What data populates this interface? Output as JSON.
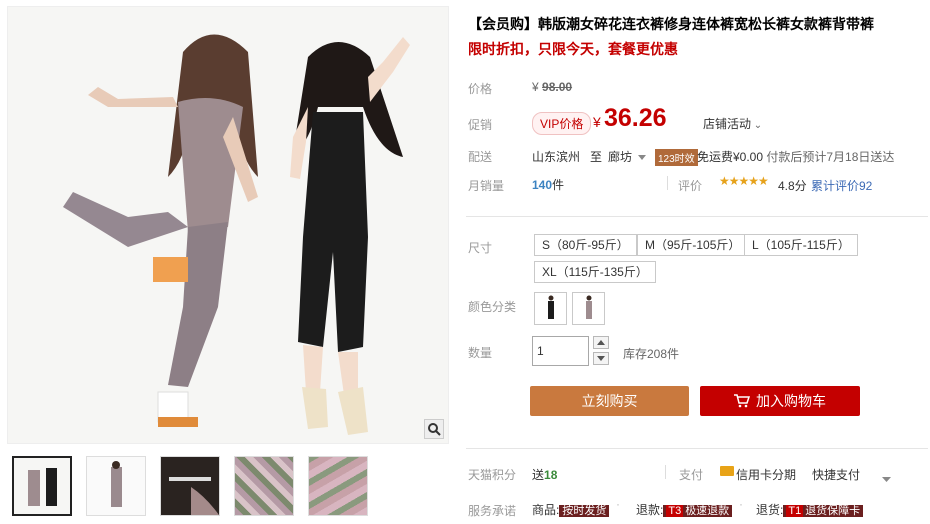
{
  "product": {
    "title": "【会员购】韩版潮女碎花连衣裤修身连体裤宽松长裤女款裤背带裤",
    "promo": "限时折扣，只限今天，套餐更优惠"
  },
  "price": {
    "label": "价格",
    "currency": "¥",
    "original": "98.00"
  },
  "promotion": {
    "label": "促销",
    "badge": "VIP价格",
    "currency": "¥",
    "price": "36.26",
    "store_activity": "店铺活动"
  },
  "shipping": {
    "label": "配送",
    "from": "山东滨州",
    "to_word": "至",
    "to": "廊坊",
    "speed_badge": "123时效",
    "fee": "免运费¥0.00",
    "eta": "付款后预计7月18日送达"
  },
  "sales": {
    "label": "月销量",
    "count": "140",
    "unit": "件",
    "rating_label": "评价",
    "stars": "★★★★★",
    "score": "4.8分",
    "reviews": "累计评价92"
  },
  "size": {
    "label": "尺寸",
    "options": [
      "S（80斤-95斤）",
      "M（95斤-105斤）",
      "L（105斤-115斤）",
      "XL（115斤-135斤）"
    ]
  },
  "color": {
    "label": "颜色分类",
    "options": [
      "black-jumpsuit",
      "floral-jumpsuit"
    ]
  },
  "quantity": {
    "label": "数量",
    "value": "1",
    "stock": "库存208件"
  },
  "actions": {
    "buy_now": "立刻购买",
    "add_to_cart": "加入购物车"
  },
  "points": {
    "label": "天猫积分",
    "prefix": "送",
    "value": "18",
    "pay_label": "支付",
    "card": "信用卡分期",
    "fast": "快捷支付"
  },
  "service": {
    "label": "服务承诺",
    "items": [
      {
        "name": "商品:",
        "tag": "按时发货",
        "badge": ""
      },
      {
        "name": "退款:",
        "tag": "极速退款",
        "badge": "T3"
      },
      {
        "name": "退货:",
        "tag": "退货保障卡",
        "badge": "T1"
      }
    ]
  },
  "colors": {
    "accent": "#c40000",
    "buy_button": "#c9793e",
    "link": "#3c6ab5"
  }
}
